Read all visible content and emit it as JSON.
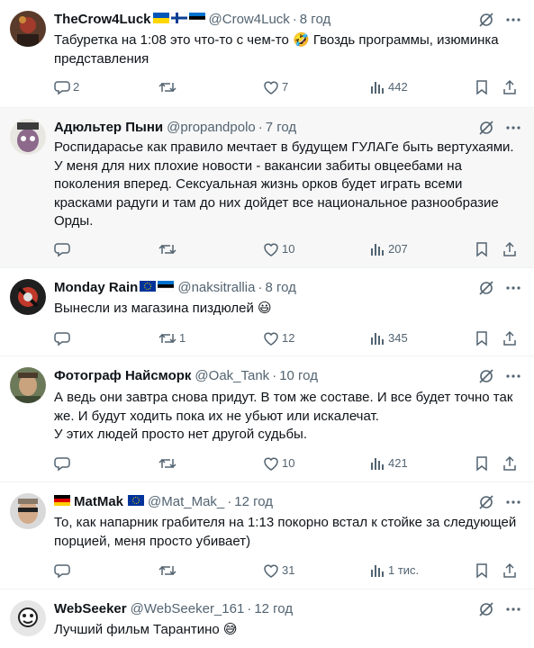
{
  "tweets": [
    {
      "name": "TheCrow4Luck",
      "flags": [
        "ua",
        "fi",
        "ee"
      ],
      "handle": "@Crow4Luck",
      "time": "8 год",
      "text_lines": [
        "Табуретка на 1:08 это что-то с чем-то 🤣 Гвоздь программы, изюминка",
        "представления"
      ],
      "replies": "2",
      "retweets": "",
      "likes": "7",
      "views": "442"
    },
    {
      "name": "Адюльтер Пыни",
      "flags": [],
      "handle": "@propandpolo",
      "time": "7 год",
      "text_lines": [
        "Роспидарасье как правило мечтает в будущем ГУЛАГе быть вертухаями.",
        "У меня для них плохие новости - вакансии забиты овцеебами на",
        "поколения вперед. Сексуальная жизнь орков будет играть всеми",
        "красками радуги и там до них дойдет все национальное разнообразие",
        "Орды."
      ],
      "replies": "",
      "retweets": "",
      "likes": "10",
      "views": "207"
    },
    {
      "name": "Monday Rain",
      "flags": [
        "eu",
        "ee"
      ],
      "handle": "@naksitrallia",
      "time": "8 год",
      "text_lines": [
        "Вынесли из магазина пиздюлей 😃"
      ],
      "replies": "",
      "retweets": "1",
      "likes": "12",
      "views": "345"
    },
    {
      "name": "Фотограф Найсморк",
      "flags": [],
      "handle": "@Oak_Tank",
      "time": "10 год",
      "text_lines": [
        "А ведь они завтра снова придут. В том же составе. И все будет точно так",
        "же. И будут ходить пока их не убьют или искалечат.",
        "У этих людей просто нет другой судьбы."
      ],
      "replies": "",
      "retweets": "",
      "likes": "10",
      "views": "421"
    },
    {
      "name": "MatMak",
      "flags": [
        "de_pre",
        "eu"
      ],
      "handle": "@Mat_Mak_",
      "time": "12 год",
      "text_lines": [
        "То, как напарник грабителя на 1:13 покорно встал к стойке за следующей",
        "порцией, меня просто убивает)"
      ],
      "replies": "",
      "retweets": "",
      "likes": "31",
      "views": "1 тис."
    },
    {
      "name": "WebSeeker",
      "flags": [],
      "handle": "@WebSeeker_161",
      "time": "12 год",
      "text_lines": [
        "Лучший фильм Тарантино 😅"
      ],
      "replies": "",
      "retweets": "",
      "likes": "",
      "views": ""
    }
  ],
  "colors": {
    "text": "#0f1419",
    "muted": "#536471",
    "divider": "#eff3f4",
    "highlight_bg": "#f7f7f7"
  }
}
